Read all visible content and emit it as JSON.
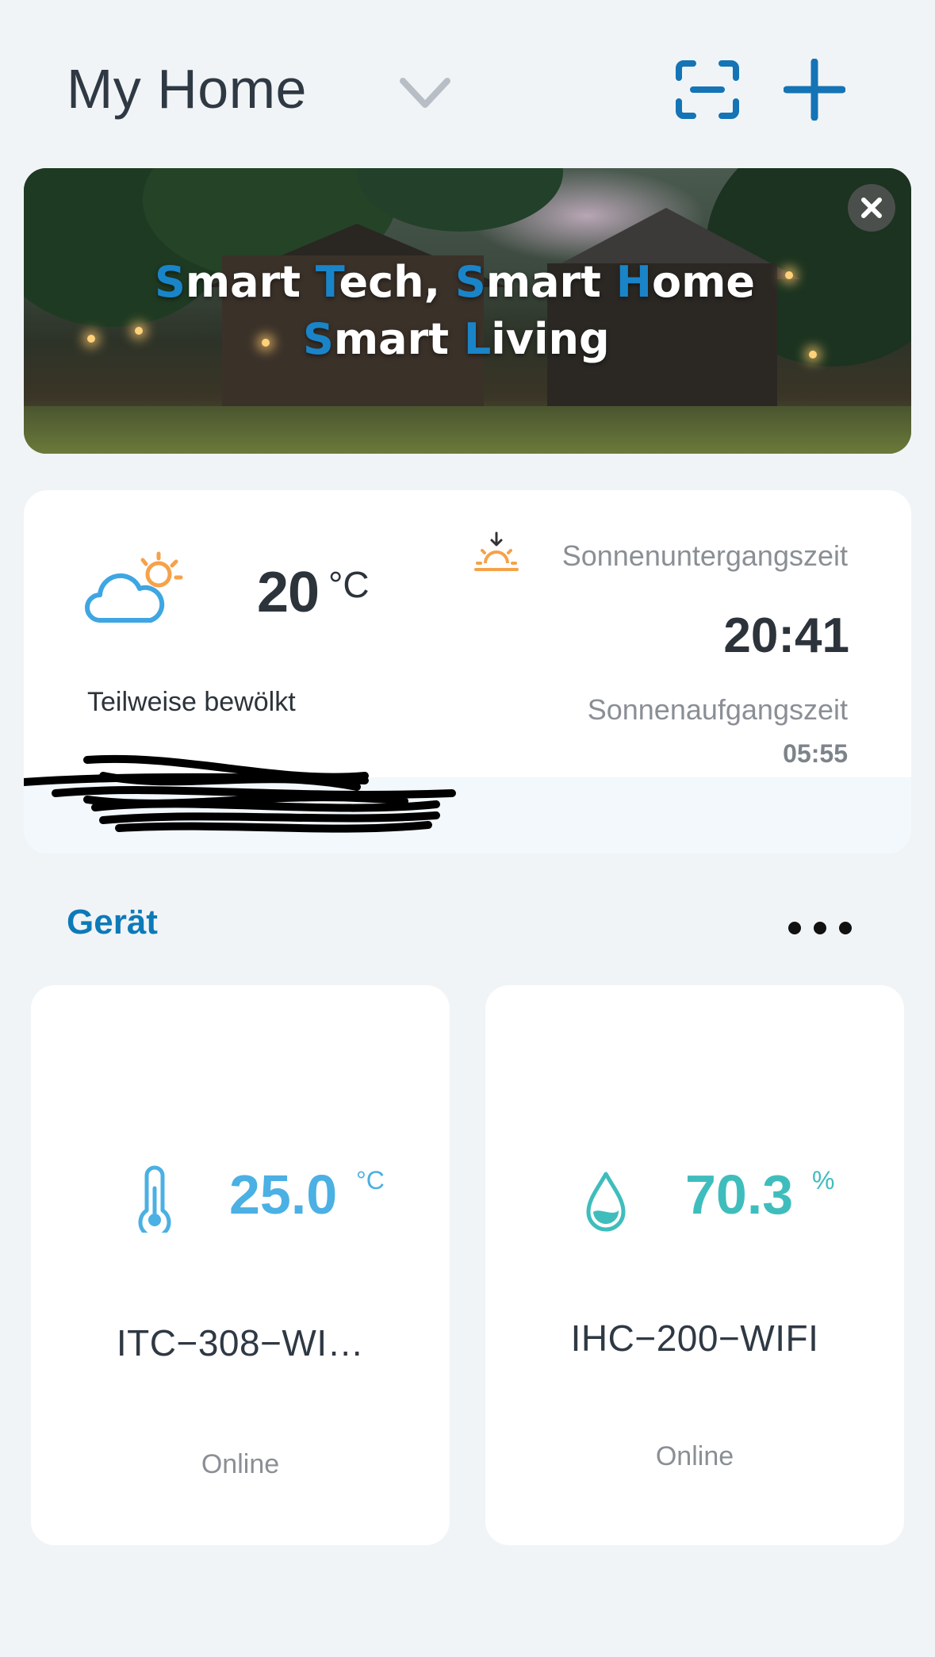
{
  "header": {
    "title": "My Home",
    "dropdown_icon": "chevron-down-icon",
    "scan_icon": "scan-icon",
    "add_icon": "plus-icon"
  },
  "banner": {
    "line1_parts": [
      "S",
      "mart ",
      "T",
      "ech, ",
      "S",
      "mart ",
      "H",
      "ome"
    ],
    "line2_parts": [
      "S",
      "mart ",
      "L",
      "iving"
    ],
    "accent_color": "#1a84c8",
    "close_icon": "close-icon"
  },
  "weather": {
    "temperature": "20",
    "unit": "°C",
    "condition": "Teilweise bewölkt",
    "sunset_label": "Sonnenuntergangszeit",
    "sunset_time": "20:41",
    "sunrise_label": "Sonnenaufgangszeit",
    "sunrise_time": "05:55"
  },
  "section": {
    "title": "Gerät",
    "more_icon": "more-dots-icon"
  },
  "devices": [
    {
      "value": "25.0",
      "unit": "°C",
      "name": "ITC−308−WI…",
      "status": "Online",
      "icon": "thermometer-icon",
      "color": "#4bb0e3"
    },
    {
      "value": "70.3",
      "unit": "%",
      "name": "IHC−200−WIFI",
      "status": "Online",
      "icon": "water-drop-icon",
      "color": "#3fbdbd"
    }
  ]
}
